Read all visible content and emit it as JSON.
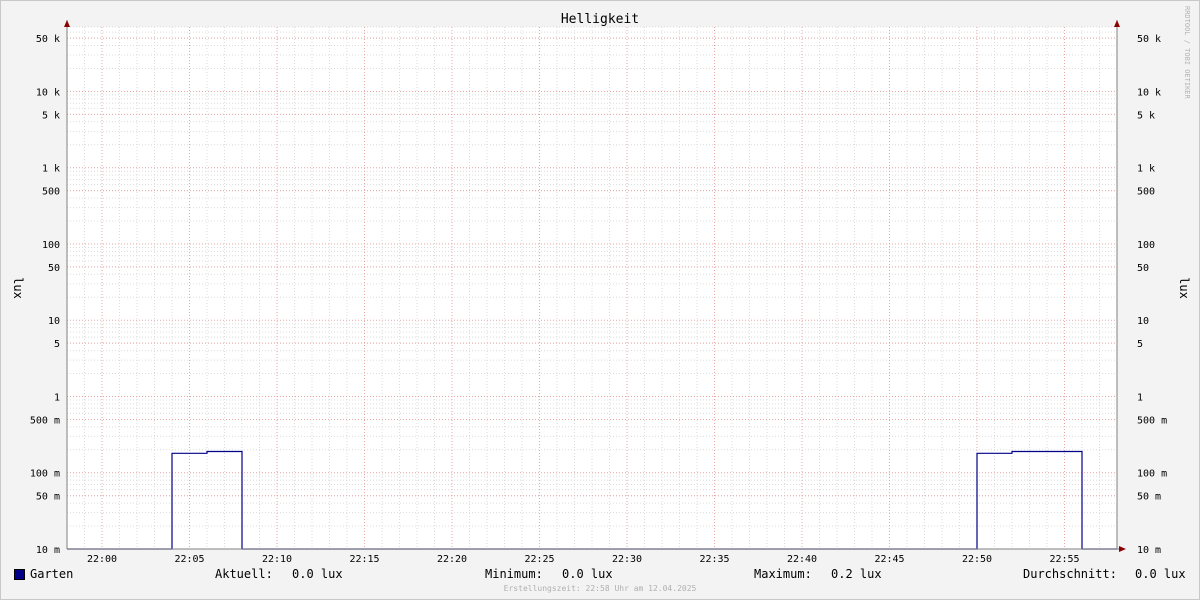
{
  "chart_data": {
    "type": "line",
    "title": "Helligkeit",
    "ylabel": "lux",
    "ylabel_right": "lux",
    "yscale": "log",
    "ylim": [
      0.01,
      70000
    ],
    "y_ticks": [
      {
        "value": 50000,
        "label": "50 k"
      },
      {
        "value": 10000,
        "label": "10 k"
      },
      {
        "value": 5000,
        "label": "5 k"
      },
      {
        "value": 1000,
        "label": "1 k"
      },
      {
        "value": 500,
        "label": "500"
      },
      {
        "value": 100,
        "label": "100"
      },
      {
        "value": 50,
        "label": "50"
      },
      {
        "value": 10,
        "label": "10"
      },
      {
        "value": 5,
        "label": "5"
      },
      {
        "value": 1,
        "label": "1"
      },
      {
        "value": 0.5,
        "label": "500 m"
      },
      {
        "value": 0.1,
        "label": "100 m"
      },
      {
        "value": 0.05,
        "label": "50 m"
      },
      {
        "value": 0.01,
        "label": "10 m"
      }
    ],
    "xlim": [
      "21:58",
      "22:58"
    ],
    "x_ticks": [
      "22:00",
      "22:05",
      "22:10",
      "22:15",
      "22:20",
      "22:25",
      "22:30",
      "22:35",
      "22:40",
      "22:45",
      "22:50",
      "22:55"
    ],
    "grid": true,
    "series": [
      {
        "name": "Garten",
        "color": "#00008b",
        "x": [
          "21:58",
          "22:04",
          "22:04",
          "22:06",
          "22:06",
          "22:08",
          "22:08",
          "22:50",
          "22:50",
          "22:52",
          "22:52",
          "22:56",
          "22:56",
          "22:58"
        ],
        "y": [
          0.01,
          0.01,
          0.18,
          0.18,
          0.19,
          0.19,
          0.01,
          0.01,
          0.18,
          0.18,
          0.19,
          0.19,
          0.01,
          0.01
        ]
      }
    ],
    "legend": {
      "position": "bottom",
      "label": "Garten",
      "aktuell_label": "Aktuell:",
      "aktuell_value": "0.0 lux",
      "minimum_label": "Minimum:",
      "minimum_value": "0.0 lux",
      "maximum_label": "Maximum:",
      "maximum_value": "0.2 lux",
      "durchschnitt_label": "Durchschnitt:",
      "durchschnitt_value": "0.0 lux"
    },
    "footer": "Erstellungszeit: 22:58 Uhr am 12.04.2025",
    "watermark": "RRDTOOL / TOBI OETIKER"
  }
}
